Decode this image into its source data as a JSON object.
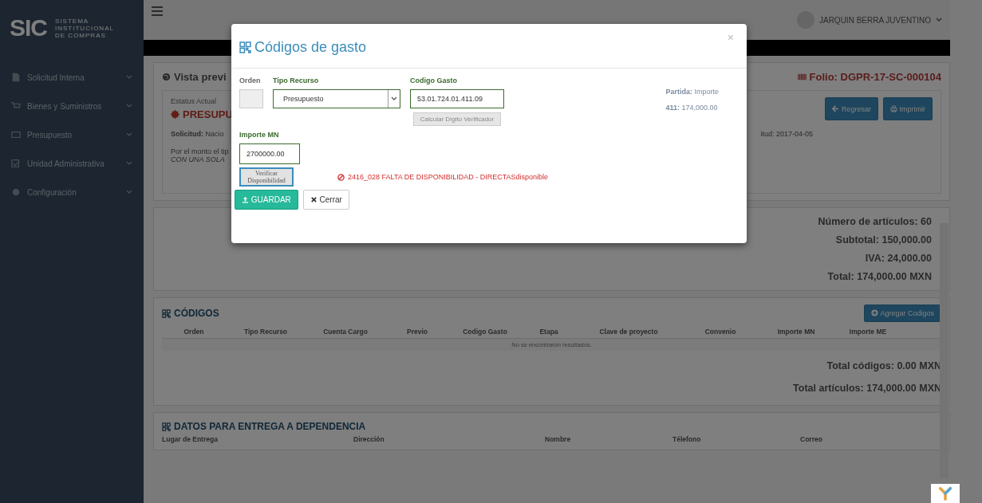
{
  "sidebar": {
    "logo": {
      "mark": "SIC",
      "lines": [
        "SISTEMA",
        "INSTITUCIONAL",
        "DE COMPRAS"
      ]
    },
    "items": [
      {
        "label": "Solicitud Interna"
      },
      {
        "label": "Bienes y Suministros"
      },
      {
        "label": "Presupuesto"
      },
      {
        "label": "Unidad Administrativa"
      },
      {
        "label": "Configuración"
      }
    ]
  },
  "topbar": {
    "user": "JARQUIN BERRA JUVENTINO"
  },
  "preview": {
    "title": "Vista previ",
    "folio": "Folio: DGPR-17-SC-000104",
    "status_label": "Estatus Actual",
    "status": "PRESUPU",
    "buttons": [
      "Regresar",
      "Imprimir"
    ],
    "solicitud": "**Solicitud:** Nacio",
    "fecha": "itud: 2017-04-05",
    "note_lines": [
      "Por el monto el tip",
      "CON UNA SOLA"
    ]
  },
  "totals": [
    "Número de artículos: 60",
    "Subtotal: 150,000.00",
    "IVA: 24,000.00",
    "Total: 174,000.00 MXN"
  ],
  "codigos": {
    "title": "CÓDIGOS",
    "add_button": "Agregar Codigos",
    "columns": [
      "Orden",
      "Tipo Recurso",
      "Cuenta Cargo",
      "Previo",
      "Codigo Gasto",
      "Etapa",
      "Clave de proyecto",
      "Convenio",
      "Importe MN",
      "Importe ME"
    ],
    "empty": "No se encontraron resultados.",
    "totals": [
      "Total códigos: 0.00 MXN",
      "Total artículos: 174,000.00 MXN"
    ]
  },
  "entrega": {
    "title": "DATOS PARA ENTREGA A DEPENDENCIA",
    "columns": [
      "Lugar de Entrega",
      "Dirección",
      "Nombre",
      "Télefono",
      "Correo"
    ]
  },
  "modal": {
    "title": "Códigos de gasto",
    "close": "×",
    "orden_label": "Orden",
    "tipo_label": "Tipo Recurso",
    "tipo_value": "Presupuesto",
    "codigo_label": "Codigo Gasto",
    "codigo_value": "53.01.724.01.411.09",
    "calc_button": {
      "label": "Calcular Dígito Verificador",
      "disabled": true
    },
    "partida": "**Partida:** Importe",
    "partida_value": "**411:** 174,000.00",
    "importe_label": "Importe MN",
    "importe_value": "2700000.00",
    "verify_button": "Verificar Disponibilidad",
    "error": "2416_028 FALTA DE DISPONIBILIDAD - DIRECTASdisponible",
    "save_button": "GUARDAR",
    "cancel_button": "Cerrar"
  }
}
